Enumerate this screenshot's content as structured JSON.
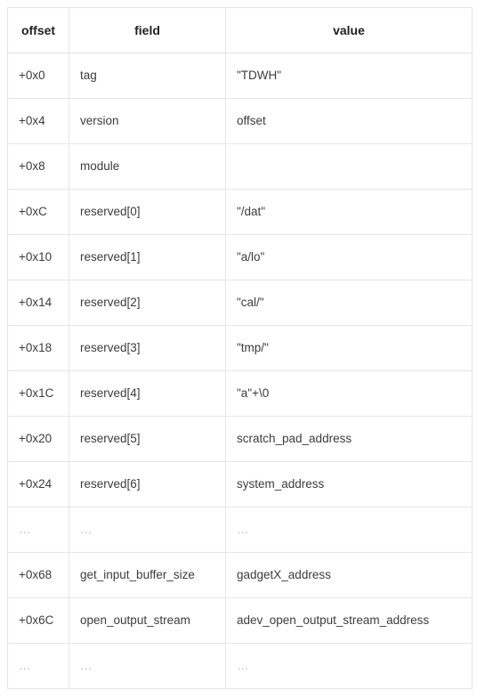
{
  "table": {
    "columns": [
      {
        "key": "offset",
        "label": "offset"
      },
      {
        "key": "field",
        "label": "field"
      },
      {
        "key": "value",
        "label": "value"
      }
    ],
    "rows": [
      {
        "offset": "+0x0",
        "field": "tag",
        "value": "\"TDWH\"",
        "ellipsis": false
      },
      {
        "offset": "+0x4",
        "field": "version",
        "value": "offset",
        "ellipsis": false
      },
      {
        "offset": "+0x8",
        "field": "module",
        "value": "",
        "ellipsis": false
      },
      {
        "offset": "+0xC",
        "field": "reserved[0]",
        "value": "\"/dat\"",
        "ellipsis": false
      },
      {
        "offset": "+0x10",
        "field": "reserved[1]",
        "value": "\"a/lo\"",
        "ellipsis": false
      },
      {
        "offset": "+0x14",
        "field": "reserved[2]",
        "value": "\"cal/\"",
        "ellipsis": false
      },
      {
        "offset": "+0x18",
        "field": "reserved[3]",
        "value": "\"tmp/\"",
        "ellipsis": false
      },
      {
        "offset": "+0x1C",
        "field": "reserved[4]",
        "value": "\"a\"+\\0",
        "ellipsis": false
      },
      {
        "offset": "+0x20",
        "field": "reserved[5]",
        "value": "scratch_pad_address",
        "ellipsis": false
      },
      {
        "offset": "+0x24",
        "field": "reserved[6]",
        "value": "system_address",
        "ellipsis": false
      },
      {
        "offset": "…",
        "field": "…",
        "value": "…",
        "ellipsis": true
      },
      {
        "offset": "+0x68",
        "field": "get_input_buffer_size",
        "value": "gadgetX_address",
        "ellipsis": false
      },
      {
        "offset": "+0x6C",
        "field": "open_output_stream",
        "value": "adev_open_output_stream_address",
        "ellipsis": false
      },
      {
        "offset": "…",
        "field": "…",
        "value": "…",
        "ellipsis": true
      }
    ]
  },
  "colors": {
    "border": "#e6e6e6",
    "header_text": "#202124",
    "body_text": "#3c3c3c",
    "ellipsis_text": "#b9b9b9",
    "background": "#ffffff"
  }
}
